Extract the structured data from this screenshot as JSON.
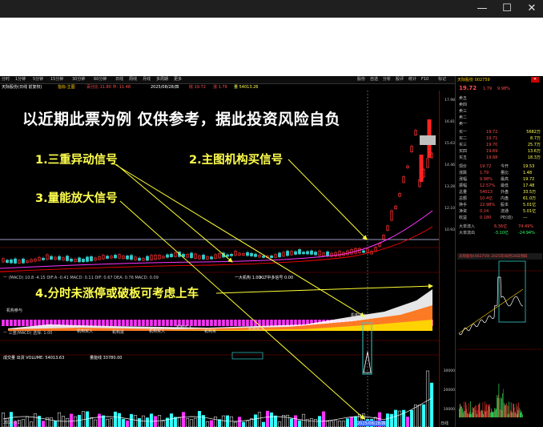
{
  "window": {
    "minimize": "—",
    "maximize": "☐",
    "close": "✕"
  },
  "menubar": {
    "items": [
      "分时",
      "1分钟",
      "5分钟",
      "15分钟",
      "30分钟",
      "60分钟",
      "日线",
      "周线",
      "月线",
      "多周期",
      "更多"
    ],
    "right": [
      "操作",
      "自选",
      "分析",
      "AI",
      "F10",
      "标记"
    ],
    "right_items": [
      "股份",
      "自选",
      "分析",
      "股评",
      "统计",
      "F10",
      "标记"
    ]
  },
  "infobar": {
    "code": "天际股份(日线 前复权)",
    "ma": "指标:主图",
    "signals": "百分比 11.80   中:  11.48",
    "date": "2025/08/28/四",
    "v1": "收 19.72",
    "v2": "涨 1.79",
    "v3": "量 54013.26"
  },
  "annotations": {
    "title": "以近期此票为例   仅供参考，据此投资风险自负",
    "sig1": "1.三重异动信号",
    "sig2": "2.主图机构买信号",
    "sig3": "3.量能放大信号",
    "sig4": "4.分时未涨停或破板可考虑上车"
  },
  "chart_labels": {
    "macd": "一 (MACD) 10.8  -4.15  DIF:A -0.41  MACD: 0.11  DIF: 0.67  DEA: 0.76  MACD: 0.09",
    "volume": "成交量 出货  VOLUME: 54013.63",
    "vol_ma": "量能线  33780.00",
    "indicator": "一 三重(MACD) 选择: 1.00",
    "date_left": "2024/11",
    "date_mid": "2025/08/28/四",
    "date_right": "日线",
    "signal_tags": [
      "机构参与",
      "机构买入",
      "机构买入",
      "机构进",
      "机构买入",
      "机构买入",
      "一机构买",
      "机构买入",
      "机构买入"
    ],
    "sell_tag": "一大机构 1.00",
    "sell_tag2": "KLT中多信号 0.00"
  },
  "axis": {
    "price": [
      "17.98",
      "16.81",
      "15.63",
      "14.46",
      "13.28",
      "12.10",
      "10.93"
    ],
    "vol": [
      "30000",
      "20000",
      "10000"
    ]
  },
  "right_panel": {
    "header": "天际股份 002759",
    "price": "19.72",
    "change": "1.79",
    "pct": "9.98%",
    "sell": [
      [
        "卖五",
        "",
        ""
      ],
      [
        "卖四",
        "",
        ""
      ],
      [
        "卖三",
        "",
        ""
      ],
      [
        "卖二",
        "",
        ""
      ],
      [
        "卖一",
        "",
        ""
      ]
    ],
    "buy": [
      [
        "买一",
        "19.72",
        "5682万"
      ],
      [
        "买二",
        "19.71",
        "8.7万"
      ],
      [
        "买三",
        "19.70",
        "25.7万"
      ],
      [
        "买四",
        "19.69",
        "13.6万"
      ],
      [
        "买五",
        "19.68",
        "18.3万"
      ]
    ],
    "stats": [
      [
        "现价",
        "19.72",
        "今开",
        "19.53"
      ],
      [
        "涨跌",
        "1.79",
        "量比",
        "1.48"
      ],
      [
        "涨幅",
        "9.98%",
        "最高",
        "19.72"
      ],
      [
        "振幅",
        "12.57%",
        "最低",
        "17.48"
      ],
      [
        "总量",
        "54013",
        "外盘",
        "33.5万"
      ],
      [
        "总额",
        "10.4亿",
        "内盘",
        "61.0万"
      ],
      [
        "换手",
        "22.98%",
        "股本",
        "5.01亿"
      ],
      [
        "净资",
        "0.24",
        "流通",
        "5.01亿"
      ],
      [
        "收益",
        "0.180",
        "PE(动)",
        "---"
      ]
    ],
    "flow": [
      [
        "大单流入",
        "6.36亿",
        "74.49%"
      ],
      [
        "大单流出",
        "-3.10亿",
        "-24.94%"
      ]
    ],
    "mini_title": "天际股份(002759)  2025年08月28日周四",
    "mini_axis": [
      "19.72",
      "18.84",
      "17.95",
      "17.07",
      "25848",
      "12924"
    ],
    "mini_times": [
      "09:30",
      "11:30",
      "15:00"
    ]
  },
  "colors": {
    "up": "#ff3333",
    "down": "#33cccc",
    "signal": "#ffff00",
    "magenta": "#ff33ff",
    "orange": "#ff6600"
  }
}
